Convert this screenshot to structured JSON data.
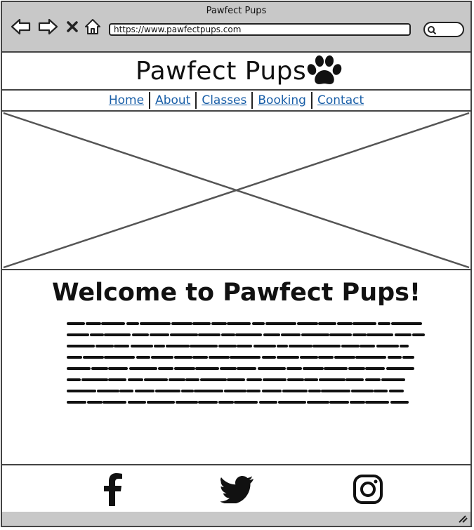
{
  "window": {
    "title": "Pawfect Pups",
    "url": "https://www.pawfectpups.com"
  },
  "toolbar": {
    "back_icon": "back-arrow-icon",
    "forward_icon": "forward-arrow-icon",
    "stop_icon": "close-icon",
    "home_icon": "home-icon",
    "search_icon": "search-icon"
  },
  "header": {
    "brand": "Pawfect Pups",
    "logo_icon": "paw-print-icon"
  },
  "nav": {
    "items": [
      {
        "label": "Home"
      },
      {
        "label": "About"
      },
      {
        "label": "Classes"
      },
      {
        "label": "Booking"
      },
      {
        "label": "Contact"
      }
    ]
  },
  "hero": {
    "image": "image-placeholder"
  },
  "main": {
    "heading": "Welcome to Pawfect Pups!",
    "body_text_lines": 8
  },
  "footer": {
    "social": [
      {
        "name": "facebook-icon"
      },
      {
        "name": "twitter-icon"
      },
      {
        "name": "instagram-icon"
      }
    ]
  },
  "colors": {
    "chrome": "#c8c8c8",
    "link": "#1a5fa8",
    "border": "#444444"
  }
}
